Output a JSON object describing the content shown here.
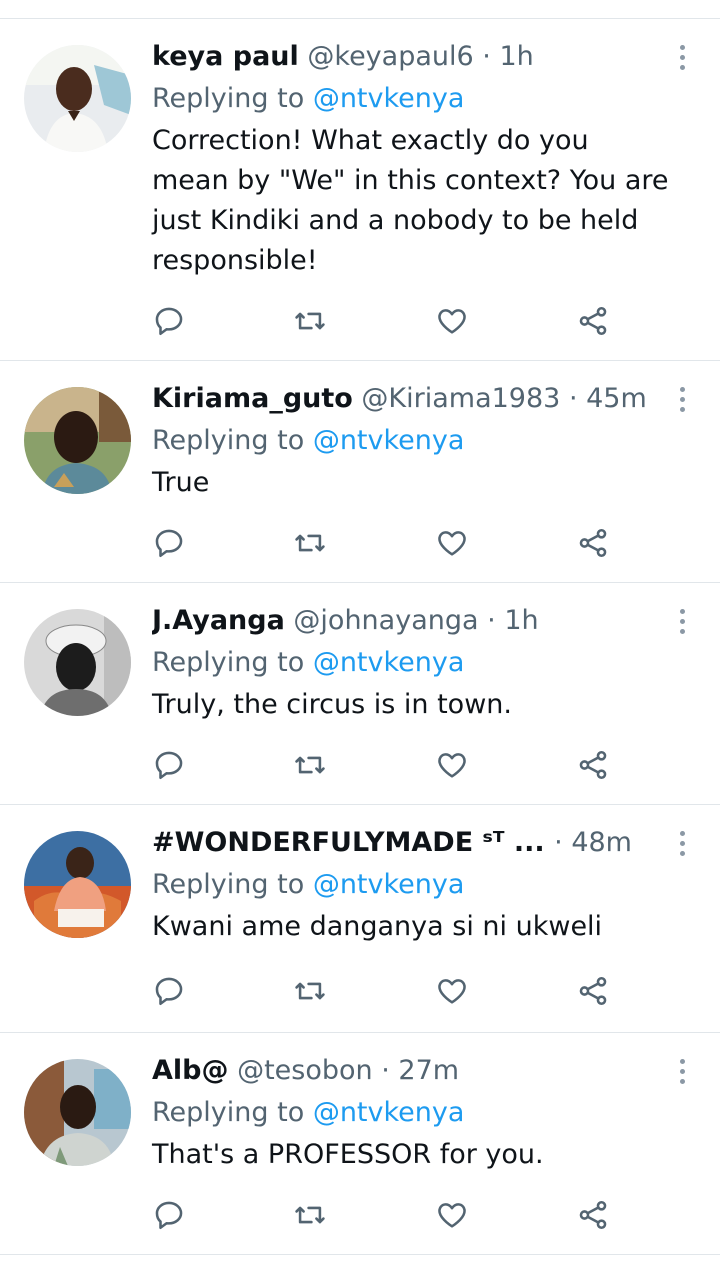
{
  "tweets": [
    {
      "name": "keya paul",
      "handle": "@keyapaul6",
      "separator": "·",
      "time": "1h",
      "replying_prefix": "Replying to",
      "replying_to": "@ntvkenya",
      "text": "Correction! What exactly do you mean by \"We\" in this context? You are just Kindiki and a nobody to be held responsible!"
    },
    {
      "name": "Kiriama_guto",
      "handle": "@Kiriama1983",
      "separator": "·",
      "time": "45m",
      "replying_prefix": "Replying to",
      "replying_to": "@ntvkenya",
      "text": "True"
    },
    {
      "name": "J.Ayanga",
      "handle": "@johnayanga",
      "separator": "·",
      "time": "1h",
      "replying_prefix": "Replying to",
      "replying_to": "@ntvkenya",
      "text": "Truly, the circus is in town."
    },
    {
      "name": "#WONDERFULYMADE ˢᵀ ...",
      "handle": "",
      "separator": "·",
      "time": "48m",
      "replying_prefix": "Replying to",
      "replying_to": "@ntvkenya",
      "text": "Kwani ame danganya si ni ukweli"
    },
    {
      "name": "Alb@",
      "handle": "@tesobon",
      "separator": "·",
      "time": "27m",
      "replying_prefix": "Replying to",
      "replying_to": "@ntvkenya",
      "text": "That's a PROFESSOR for you."
    }
  ],
  "icons": {
    "reply": "reply-icon",
    "retweet": "retweet-icon",
    "like": "heart-icon",
    "share": "share-icon",
    "more": "more-options-icon"
  },
  "colors": {
    "mention": "#1d9bf0",
    "secondary_text": "#536471",
    "primary_text": "#0f1419",
    "divider": "#e1e6ea"
  }
}
